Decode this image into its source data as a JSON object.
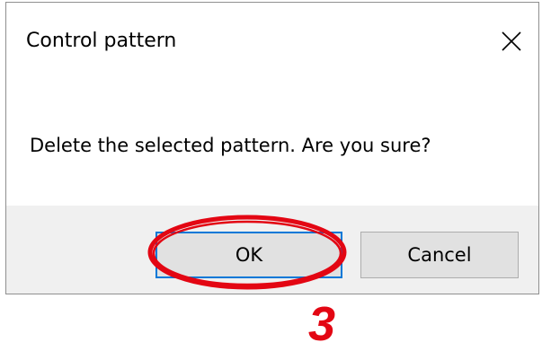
{
  "dialog": {
    "title": "Control pattern",
    "close_icon": "close-icon",
    "message": "Delete the selected pattern. Are you sure?",
    "ok_label": "OK",
    "cancel_label": "Cancel"
  },
  "annotation": {
    "step": "3",
    "color": "#e30613"
  },
  "colors": {
    "footer_bg": "#f0f0f0",
    "button_bg": "#e1e1e1",
    "focus_border": "#0078d7"
  }
}
